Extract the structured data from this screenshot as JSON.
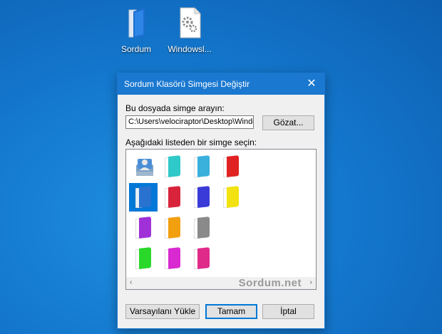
{
  "desktop": {
    "icons": [
      {
        "label": "Sordum",
        "icon": "blue-folder-icon"
      },
      {
        "label": "Windowsl...",
        "icon": "settings-file-icon"
      }
    ]
  },
  "dialog": {
    "title": "Sordum Klasörü Simgesi Değiştir",
    "close_glyph": "✕",
    "file_label": "Bu dosyada simge arayın:",
    "file_path": "C:\\Users\\velociraptor\\Desktop\\Windo",
    "browse_label": "Gözat...",
    "list_label": "Aşağıdaki listeden bir simge seçin:",
    "icons": [
      {
        "name": "users-folder-icon",
        "color": "#3a8ad6"
      },
      {
        "name": "cyan-folder-icon",
        "color": "#2fc9c9"
      },
      {
        "name": "lightblue-folder-icon",
        "color": "#3ab0dd"
      },
      {
        "name": "red-folder-icon",
        "color": "#e02222"
      },
      {
        "name": "blue-folder-icon",
        "color": "#2a72d0",
        "selected": true
      },
      {
        "name": "crimson-folder-icon",
        "color": "#d8233a"
      },
      {
        "name": "navy-folder-icon",
        "color": "#3a3ad8"
      },
      {
        "name": "yellow-folder-icon",
        "color": "#f2e20f"
      },
      {
        "name": "purple-folder-icon",
        "color": "#a030d8"
      },
      {
        "name": "orange-folder-icon",
        "color": "#f2a010"
      },
      {
        "name": "gray-folder-icon",
        "color": "#8a8a8a"
      },
      {
        "name": "green-folder-icon",
        "color": "#2ad82a"
      },
      {
        "name": "magenta-folder-icon",
        "color": "#d82ad0"
      },
      {
        "name": "pink-folder-icon",
        "color": "#e02a8a"
      }
    ],
    "scroll_left": "‹",
    "scroll_right": "›",
    "watermark": "Sordum.net",
    "buttons": {
      "reset": "Varsayılanı Yükle",
      "ok": "Tamam",
      "cancel": "İptal"
    }
  }
}
